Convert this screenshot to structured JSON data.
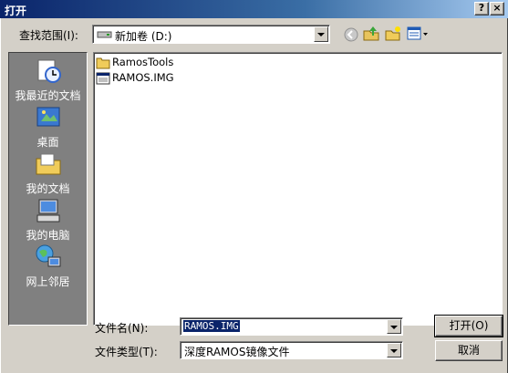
{
  "window": {
    "title": "打开",
    "help_label": "?",
    "close_label": "×"
  },
  "lookin": {
    "label": "查找范围(I):",
    "value": "新加卷 (D:)"
  },
  "places": [
    {
      "label": "我最近的文档"
    },
    {
      "label": "桌面"
    },
    {
      "label": "我的文档"
    },
    {
      "label": "我的电脑"
    },
    {
      "label": "网上邻居"
    }
  ],
  "files": [
    {
      "name": "RamosTools",
      "kind": "folder"
    },
    {
      "name": "RAMOS.IMG",
      "kind": "file"
    }
  ],
  "filename": {
    "label": "文件名(N):",
    "value": "RAMOS.IMG"
  },
  "filetype": {
    "label": "文件类型(T):",
    "value": "深度RAMOS镜像文件"
  },
  "buttons": {
    "open": "打开(O)",
    "cancel": "取消"
  },
  "colors": {
    "title_start": "#0a246a",
    "title_end": "#a6caf0",
    "places_bg": "#808080",
    "dialog_bg": "#d4d0c8",
    "selection": "#0a246a"
  }
}
